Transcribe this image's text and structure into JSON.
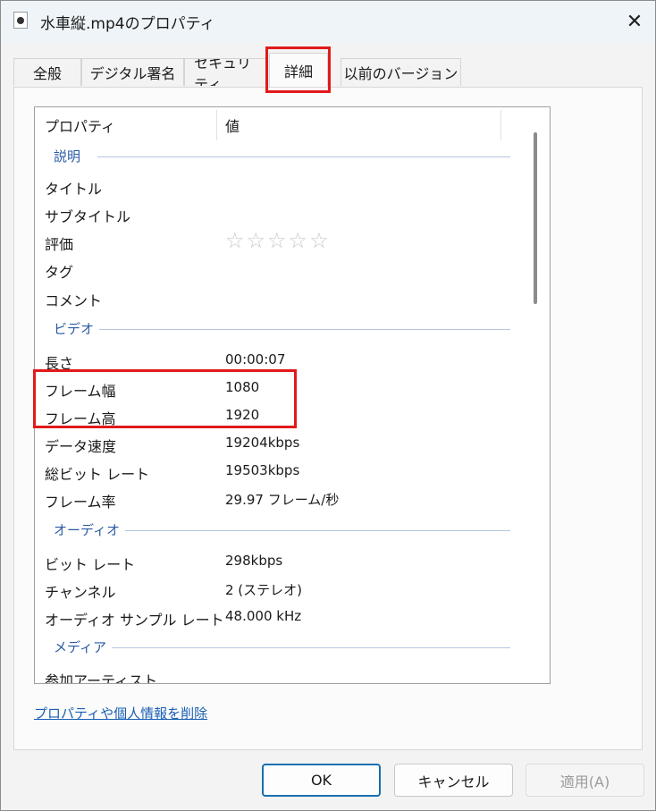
{
  "window": {
    "title": "水車縦.mp4のプロパティ",
    "close_glyph": "✕"
  },
  "tabs": [
    {
      "label": "全般"
    },
    {
      "label": "デジタル署名"
    },
    {
      "label": "セキュリティ"
    },
    {
      "label": "詳細",
      "active": true
    },
    {
      "label": "以前のバージョン"
    }
  ],
  "columns": {
    "property": "プロパティ",
    "value": "値"
  },
  "groups": {
    "description": "説明",
    "video": "ビデオ",
    "audio": "オーディオ",
    "media": "メディア"
  },
  "rows": {
    "title": {
      "name": "タイトル",
      "value": ""
    },
    "subtitle": {
      "name": "サブタイトル",
      "value": ""
    },
    "rating": {
      "name": "評価",
      "stars": 0,
      "max_stars": 5
    },
    "tags": {
      "name": "タグ",
      "value": ""
    },
    "comment": {
      "name": "コメント",
      "value": ""
    },
    "length": {
      "name": "長さ",
      "value": "00:00:07"
    },
    "frame_width": {
      "name": "フレーム幅",
      "value": "1080"
    },
    "frame_height": {
      "name": "フレーム高",
      "value": "1920"
    },
    "data_rate": {
      "name": "データ速度",
      "value": "19204kbps"
    },
    "total_bitrate": {
      "name": "総ビット レート",
      "value": "19503kbps"
    },
    "frame_rate": {
      "name": "フレーム率",
      "value": "29.97 フレーム/秒"
    },
    "audio_bitrate": {
      "name": "ビット レート",
      "value": "298kbps"
    },
    "channels": {
      "name": "チャンネル",
      "value": "2 (ステレオ)"
    },
    "sample_rate": {
      "name": "オーディオ サンプル レート",
      "value": "48.000 kHz"
    },
    "contributing_artists": {
      "name": "参加アーティスト",
      "value": ""
    }
  },
  "remove_link": "プロパティや個人情報を削除",
  "buttons": {
    "ok": "OK",
    "cancel": "キャンセル",
    "apply": "適用(A)"
  },
  "colors": {
    "highlight": "#e21a1a",
    "group_label": "#2a5aa5",
    "link": "#1a5fb4"
  }
}
